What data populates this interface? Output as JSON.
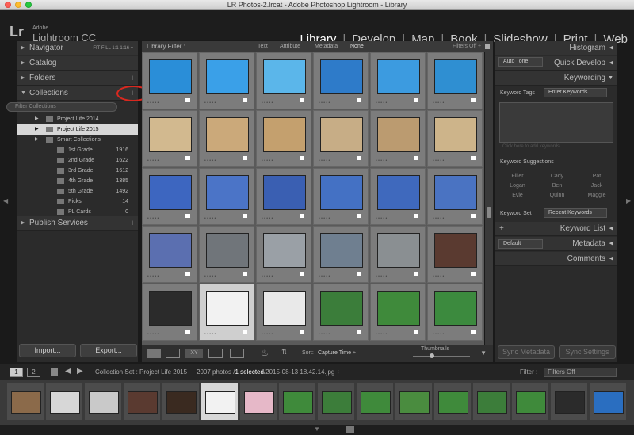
{
  "window": {
    "title": "LR Photos-2.lrcat - Adobe Photoshop Lightroom - Library"
  },
  "brand": {
    "logo": "Lr",
    "company": "Adobe",
    "product": "Lightroom CC"
  },
  "modules": [
    "Library",
    "Develop",
    "Map",
    "Book",
    "Slideshow",
    "Print",
    "Web"
  ],
  "active_module": "Library",
  "left_panel": {
    "navigator": {
      "label": "Navigator",
      "options": "FIT  FILL  1:1  1:16 ÷"
    },
    "catalog": {
      "label": "Catalog"
    },
    "folders": {
      "label": "Folders"
    },
    "collections": {
      "label": "Collections",
      "filter_placeholder": "Filter Collections",
      "items": [
        {
          "name": "Project Life 2014",
          "count": ""
        },
        {
          "name": "Project Life 2015",
          "count": ""
        },
        {
          "name": "Smart Collections",
          "count": ""
        },
        {
          "name": "1st Grade",
          "count": "1916"
        },
        {
          "name": "2nd Grade",
          "count": "1622"
        },
        {
          "name": "3rd Grade",
          "count": "1612"
        },
        {
          "name": "4th Grade",
          "count": "1385"
        },
        {
          "name": "5th Grade",
          "count": "1492"
        },
        {
          "name": "Picks",
          "count": "14"
        },
        {
          "name": "PL Cards",
          "count": "0"
        }
      ]
    },
    "publish": {
      "label": "Publish Services"
    },
    "import_label": "Import...",
    "export_label": "Export..."
  },
  "filter_bar": {
    "title": "Library Filter :",
    "tabs": [
      "Text",
      "Attribute",
      "Metadata",
      "None"
    ],
    "active_tab": "None",
    "preset": "Filters Off ÷"
  },
  "toolbar": {
    "xy_label": "XY",
    "sort_label": "Sort:",
    "sort_value": "Capture Time ÷",
    "thumbnails_label": "Thumbnails"
  },
  "right_panel": {
    "histogram": "Histogram",
    "quick_develop": "Quick Develop",
    "auto_tone": "Auto Tone",
    "keywording": "Keywording",
    "keyword_tags_label": "Keyword Tags",
    "keyword_tags_value": "Enter Keywords",
    "keyword_hint": "Click here to add keywords",
    "suggestions_label": "Keyword Suggestions",
    "suggestions": [
      "Filler",
      "Cady",
      "Pat",
      "Logan",
      "Ben",
      "Jack",
      "Evie",
      "Quinn",
      "Maggie"
    ],
    "keyword_set_label": "Keyword Set",
    "keyword_set_value": "Recent Keywords",
    "keyword_list": "Keyword List",
    "metadata": "Metadata",
    "metadata_preset": "Default",
    "comments": "Comments",
    "sync_metadata": "Sync Metadata",
    "sync_settings": "Sync Settings"
  },
  "filmstrip_bar": {
    "view1": "1",
    "view2": "2",
    "source": "Collection Set : Project Life 2015",
    "count_prefix": "2007 photos /",
    "selected": "1 selected",
    "file": "/2015-08-13 18.42.14.jpg ÷",
    "filter_label": "Filter :",
    "filter_value": "Filters Off"
  },
  "colors": {
    "accent": "#ffffff",
    "panel": "#2b2b2b",
    "grid_bg": "#5a5a5a",
    "annotation": "#d9281f"
  }
}
